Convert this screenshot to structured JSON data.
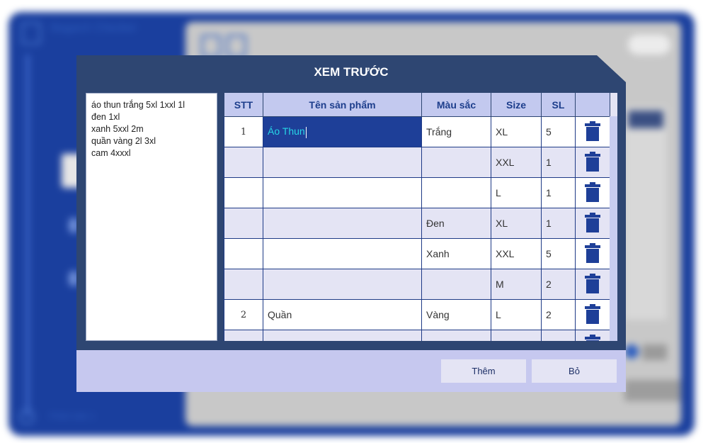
{
  "background_app": {
    "title": "BaganX Checker",
    "footer_text": "Phiên bản 1"
  },
  "dialog": {
    "title": "XEM TRƯỚC",
    "input_lines": [
      "áo thun trắng 5xl 1xxl 1l",
      "đen 1xl",
      "xanh 5xxl 2m",
      "quần vàng 2l 3xl",
      "cam 4xxxl"
    ],
    "table": {
      "headers": {
        "stt": "STT",
        "name": "Tên sản phẩm",
        "color": "Màu sắc",
        "size": "Size",
        "qty": "SL"
      },
      "rows": [
        {
          "stt": "1",
          "name": "Áo Thun",
          "color": "Trắng",
          "size": "XL",
          "qty": "5"
        },
        {
          "stt": "",
          "name": "",
          "color": "",
          "size": "XXL",
          "qty": "1"
        },
        {
          "stt": "",
          "name": "",
          "color": "",
          "size": "L",
          "qty": "1"
        },
        {
          "stt": "",
          "name": "",
          "color": "Đen",
          "size": "XL",
          "qty": "1"
        },
        {
          "stt": "",
          "name": "",
          "color": "Xanh",
          "size": "XXL",
          "qty": "5"
        },
        {
          "stt": "",
          "name": "",
          "color": "",
          "size": "M",
          "qty": "2"
        },
        {
          "stt": "2",
          "name": "Quần",
          "color": "Vàng",
          "size": "L",
          "qty": "2"
        },
        {
          "stt": "",
          "name": "",
          "color": "",
          "size": "",
          "qty": ""
        }
      ]
    },
    "buttons": {
      "add": "Thêm",
      "cancel": "Bỏ"
    },
    "colors": {
      "header_bg": "#2e4672",
      "active_cell": "#1e3f98",
      "active_text": "#26d6e6",
      "trash": "#1e3f98"
    }
  }
}
